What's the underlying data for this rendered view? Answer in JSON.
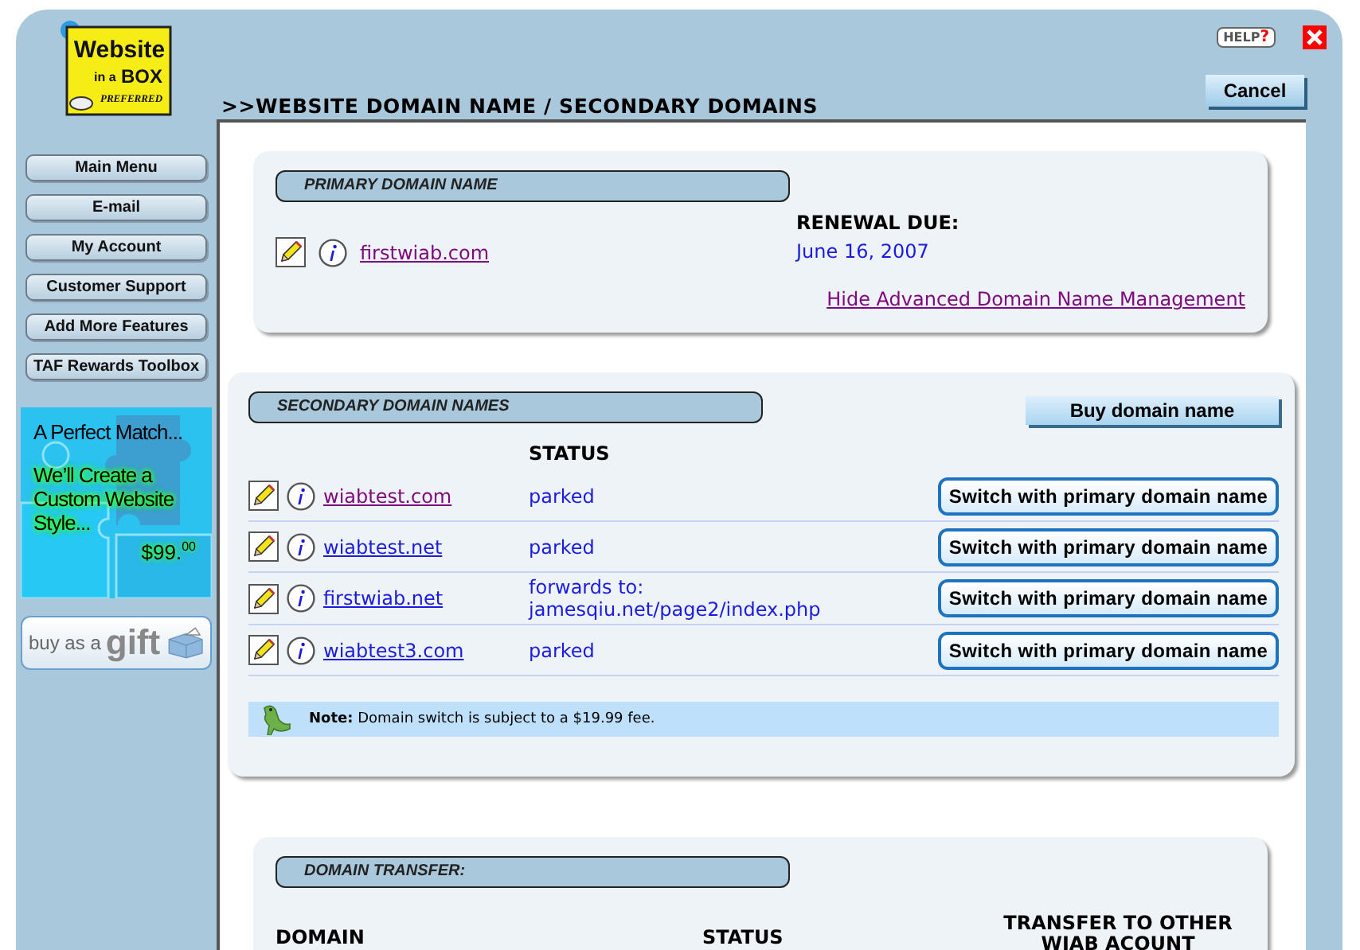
{
  "header": {
    "logo": {
      "word": "Website",
      "small": "in a",
      "box": "BOX",
      "tier": "PREFERRED"
    },
    "breadcrumb": ">>WEBSITE DOMAIN NAME / SECONDARY DOMAINS",
    "help": {
      "label": "HELP",
      "mark": "?"
    },
    "cancel": "Cancel"
  },
  "sidebar": {
    "items": [
      "Main Menu",
      "E-mail",
      "My Account",
      "Customer Support",
      "Add More Features",
      "TAF Rewards Toolbox"
    ],
    "promo": {
      "headline": "A Perfect Match...",
      "text": "We’ll Create a Custom Website Style...",
      "price": "$99.$^{00}$"
    },
    "gift": {
      "prefix": "buy as a",
      "word": "gift"
    }
  },
  "primary": {
    "title": "PRIMARY DOMAIN NAME",
    "domain": {
      "name": "firstwiab.com",
      "visited": true
    },
    "renewal_label": "RENEWAL DUE:",
    "renewal_date": "June 16, 2007",
    "toggle_link": "Hide Advanced Domain Name Management"
  },
  "secondary": {
    "title": "SECONDARY DOMAIN NAMES",
    "buy_button": "Buy domain name",
    "status_heading": "STATUS",
    "rows": [
      {
        "name": "wiabtest.com",
        "visited": true,
        "status": [
          "parked"
        ],
        "action": "Switch with primary domain name"
      },
      {
        "name": "wiabtest.net",
        "visited": false,
        "status": [
          "parked"
        ],
        "action": "Switch with primary domain name"
      },
      {
        "name": "firstwiab.net",
        "visited": false,
        "status": [
          "forwards to:",
          "jamesqiu.net/page2/index.php"
        ],
        "action": "Switch with primary domain name"
      },
      {
        "name": "wiabtest3.com",
        "visited": false,
        "status": [
          "parked"
        ],
        "action": "Switch with primary domain name"
      }
    ],
    "note": "**Note:** Domain switch is subject to a $19.99 fee."
  },
  "transfer": {
    "title": "DOMAIN TRANSFER:",
    "columns": [
      "DOMAIN",
      "STATUS",
      "TRANSFER TO OTHER WIAB ACOUNT"
    ]
  }
}
